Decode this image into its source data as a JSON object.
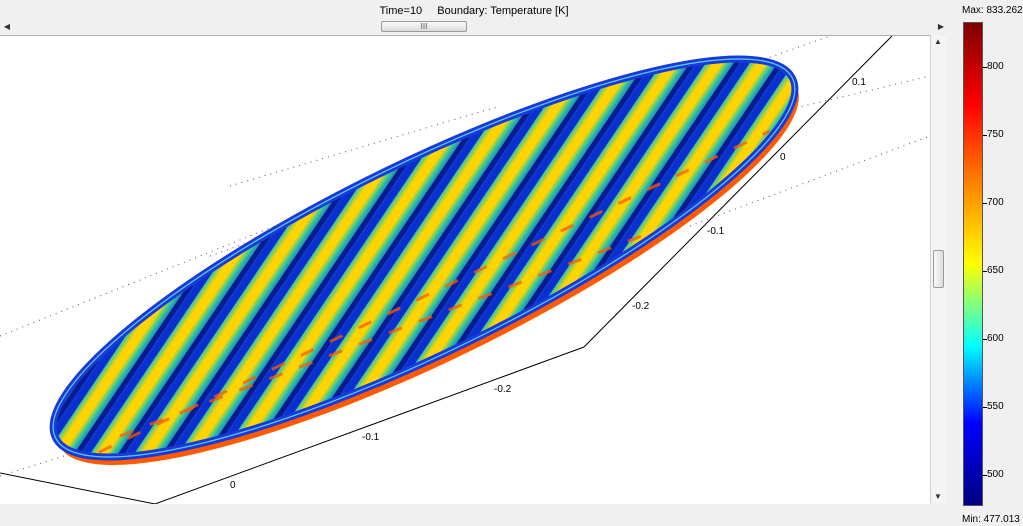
{
  "header": {
    "time_label": "Time=10",
    "boundary_label": "Boundary: Temperature [K]"
  },
  "scrollbar": {
    "grip_label": "III"
  },
  "colorbar": {
    "max_label": "Max: 833.262",
    "min_label": "Min: 477.013",
    "ticks": [
      "800",
      "750",
      "700",
      "650",
      "600",
      "550",
      "500"
    ],
    "colors": [
      "#00007f",
      "#0000ff",
      "#00ffff",
      "#ffff00",
      "#ff8000",
      "#ff0000",
      "#7f0000"
    ]
  },
  "axes": {
    "x_ticks": [
      "0",
      "-0.1",
      "-0.2"
    ],
    "y_ticks": [
      "0.1",
      "0",
      "-0.1",
      "-0.2"
    ]
  },
  "surface": {
    "stripe_count": 22,
    "hot_color": "#ff5a00",
    "warm_color": "#ffd400",
    "mid_color": "#30c8a0",
    "cold_color": "#0a2fd0"
  }
}
